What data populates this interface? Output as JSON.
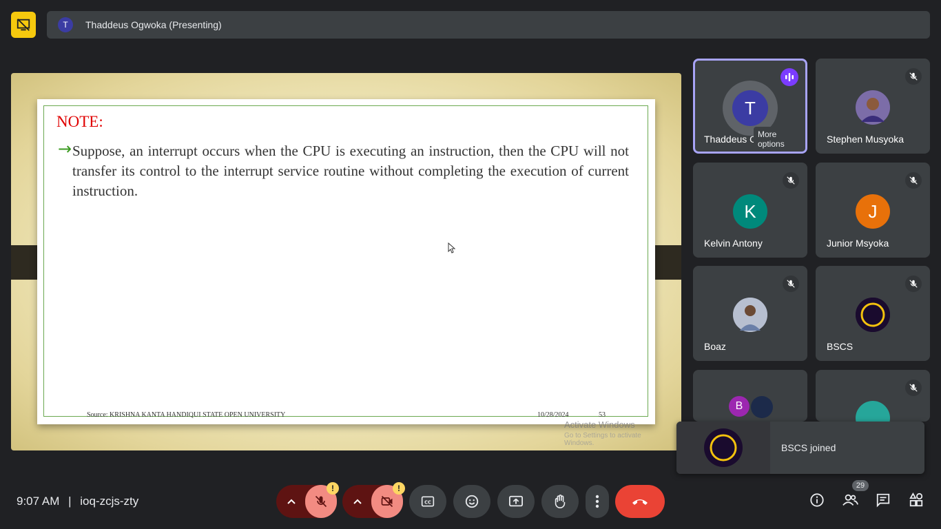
{
  "top_bar": {
    "presenter_initial": "T",
    "presenter_title": "Thaddeus Ogwoka (Presenting)"
  },
  "slide": {
    "title": "NOTE:",
    "bullet_text": "Suppose, an interrupt occurs when the CPU is executing an instruction, then the CPU will not transfer its control to the interrupt service routine without completing the execution of current instruction.",
    "source": "Source: KRISHNA KANTA HANDIQUI STATE OPEN UNIVERSITY",
    "date": "10/28/2024",
    "page_number": "53",
    "watermark_title": "Activate Windows",
    "watermark_subtitle": "Go to Settings to activate Windows."
  },
  "participants": [
    {
      "name": "Thaddeus Ogwoka",
      "initial": "T",
      "avatar_color": "#3b3ca3",
      "speaking": true
    },
    {
      "name": "Stephen Musyoka",
      "initial": "",
      "avatar_color": "#6b5a8c",
      "muted": true
    },
    {
      "name": "Kelvin Antony",
      "initial": "K",
      "avatar_color": "#00897b",
      "muted": true
    },
    {
      "name": "Junior Msyoka",
      "initial": "J",
      "avatar_color": "#e8710a",
      "muted": true
    },
    {
      "name": "Boaz",
      "initial": "",
      "avatar_color": "#8a8fa0",
      "muted": true
    },
    {
      "name": "BSCS",
      "initial": "",
      "avatar_color": "#1a0b2e",
      "muted": true
    },
    {
      "name": "",
      "initial": "B",
      "avatar_color": "#9c27b0"
    },
    {
      "name": "",
      "initial": "",
      "avatar_color": "#26a69a",
      "muted": true
    }
  ],
  "tooltip": "More options",
  "toast": {
    "message": "BSCS joined"
  },
  "meeting": {
    "time": "9:07 AM",
    "separator": "|",
    "code": "ioq-zcjs-zty"
  },
  "controls": {
    "warning_glyph": "!"
  },
  "people_count": "29",
  "colors": {
    "end_call": "#ea4335",
    "mic_off_bg": "#f28b82",
    "warning": "#fdd663",
    "accent_purple": "#7b3cff"
  }
}
